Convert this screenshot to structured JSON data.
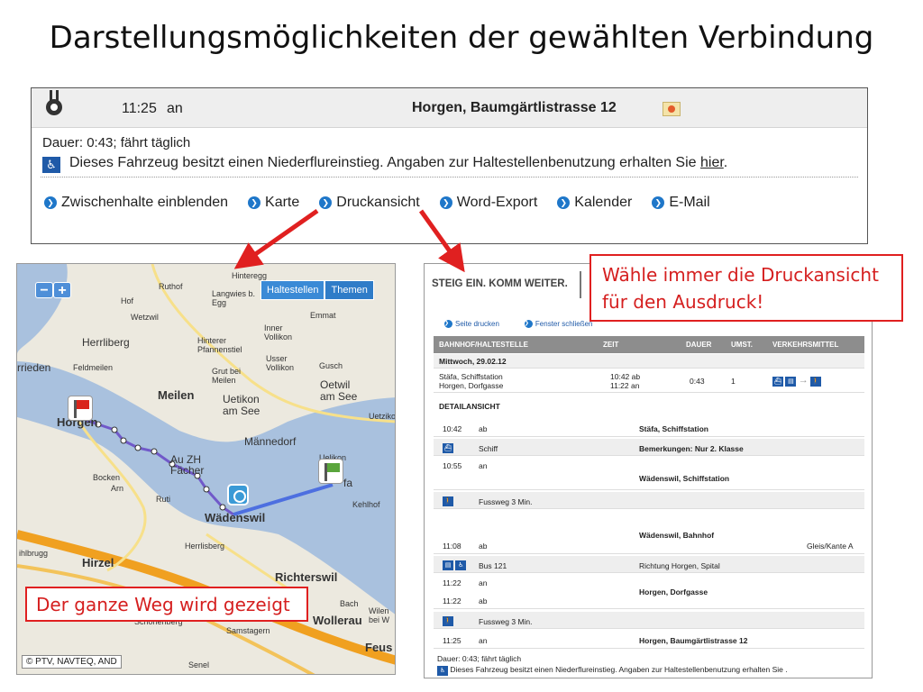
{
  "slide_title": "Darstellungsmöglichkeiten der gewählten Verbindung",
  "top_panel": {
    "arrival_time": "11:25",
    "arrival_type": "an",
    "arrival_station": "Horgen, Baumgärtlistrasse 12",
    "duration_text": "Dauer: 0:43; fährt täglich",
    "wheelchair_text": "Dieses Fahrzeug besitzt einen Niederflureinstieg. Angaben zur Haltestellenbenutzung erhalten Sie",
    "wheelchair_link": "hier",
    "links": [
      "Zwischenhalte einblenden",
      "Karte",
      "Druckansicht",
      "Word-Export",
      "Kalender",
      "E-Mail"
    ]
  },
  "map": {
    "zoom_minus": "−",
    "zoom_plus": "+",
    "tabs": [
      "Haltestellen",
      "Themen"
    ],
    "labels": {
      "hinteregg": "Hinteregg",
      "ruthof": "Ruthof",
      "langwies": "Langwies b. Egg",
      "hof": "Hof",
      "wetzwil": "Wetzwil",
      "inner_vollikon": "Inner Vollikon",
      "emmat": "Emmat",
      "herrliberg": "Herrliberg",
      "hinterer_pfannenstiel": "Hinterer Pfannenstiel",
      "usser_vollikon": "Usser Vollikon",
      "rrieden": "rrieden",
      "feldmeilen": "Feldmeilen",
      "grut_bei_meilen": "Grut bei Meilen",
      "gusch": "Gusch",
      "meilen": "Meilen",
      "uetikon": "Uetikon am See",
      "oetwil": "Oetwil am See",
      "horgen": "Horgen",
      "uetzikon": "Uetziko",
      "maennedorf": "Männedorf",
      "uelikon": "Uelikon",
      "au_zh": "Au ZH",
      "faecher": "Fächer",
      "stafa": "fa",
      "bocken": "Bocken",
      "arn": "Arn",
      "ruti": "Ruti",
      "kehlhof": "Kehlhof",
      "waedenswil": "Wädenswil",
      "herrlisberg": "Herrlisberg",
      "hirzel": "Hirzel",
      "ihlbrugg": "ihlbrugg",
      "richterswil": "Richterswil",
      "bach": "Bach",
      "schoenenberg": "Schönenberg",
      "samstagern": "Samstagern",
      "wollerau": "Wollerau",
      "wilen": "Wilen bei W",
      "feus": "Feus",
      "senel": "Senel"
    },
    "copyright": "© PTV, NAVTEQ, AND"
  },
  "print_view": {
    "brand": "STEIG EIN. KOMM WEITER.",
    "actions": [
      "Seite drucken",
      "Fenster schließen"
    ],
    "columns": [
      "BAHNHOF/HALTESTELLE",
      "ZEIT",
      "DAUER",
      "UMST.",
      "VERKEHRSMITTEL"
    ],
    "date": "Mittwoch, 29.02.12",
    "summary": {
      "from": "Stäfa, Schiffstation",
      "to": "Horgen, Dorfgasse",
      "dep": "10:42 ab",
      "arr": "11:22 an",
      "duration": "0:43",
      "changes": "1"
    },
    "detail_title": "DETAILANSICHT",
    "details": [
      {
        "time": "10:42",
        "type": "ab",
        "info": "Stäfa, Schiffstation"
      },
      {
        "mode": "Schiff",
        "info": "Bemerkungen: Nur 2. Klasse"
      },
      {
        "time": "10:55",
        "type": "an",
        "info": "Wädenswil, Schiffstation"
      },
      {
        "mode": "Fussweg 3 Min."
      },
      {
        "time": "11:08",
        "type": "ab",
        "info": "Wädenswil, Bahnhof",
        "extra": "Gleis/Kante A"
      },
      {
        "mode": "Bus 121",
        "info": "Richtung Horgen, Spital"
      },
      {
        "time": "11:22",
        "type": "an"
      },
      {
        "time": "11:22",
        "type": "ab",
        "info": "Horgen, Dorfgasse"
      },
      {
        "mode": "Fussweg 3 Min."
      },
      {
        "time": "11:25",
        "type": "an",
        "info": "Horgen, Baumgärtlistrasse 12"
      }
    ],
    "footer_duration": "Dauer: 0:43; fährt täglich",
    "footer_wheelchair": "Dieses Fahrzeug besitzt einen Niederflureinstieg. Angaben zur Haltestellenbenutzung erhalten Sie      ."
  },
  "callouts": {
    "print": "Wähle immer die Druckansicht für den Ausdruck!",
    "map": "Der ganze Weg wird gezeigt"
  },
  "colors": {
    "link_bullet": "#1f77c9",
    "callout_red": "#e02020",
    "lake": "#a9c1de",
    "route_walk": "#7059c9",
    "route_boat": "#4d6fe0"
  }
}
